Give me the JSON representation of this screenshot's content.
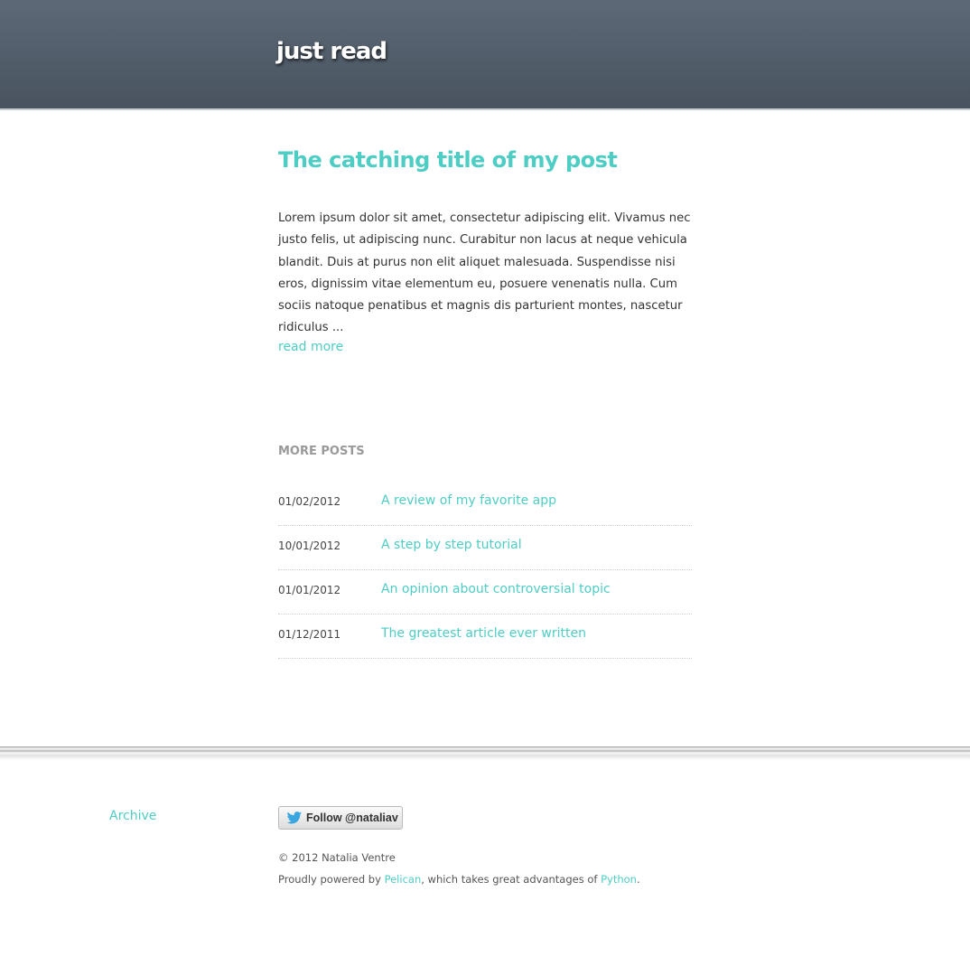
{
  "header": {
    "site_title": "just read"
  },
  "post": {
    "title": "The catching title of my post",
    "summary": "Lorem ipsum dolor sit amet, consectetur adipiscing elit. Vivamus nec justo felis, ut adipiscing nunc. Curabitur non lacus at neque vehicula blandit. Duis at purus non elit aliquet malesuada. Suspendisse nisi eros, dignissim vitae elementum eu, posuere venenatis nulla. Cum sociis natoque penatibus et magnis dis parturient montes, nascetur ridiculus ...",
    "read_more": "read more"
  },
  "more_posts": {
    "heading": "MORE POSTS",
    "items": [
      {
        "date": "01/02/2012",
        "title": "A review of my favorite app"
      },
      {
        "date": "10/01/2012",
        "title": "A step by step tutorial"
      },
      {
        "date": "01/01/2012",
        "title": "An opinion about controversial topic"
      },
      {
        "date": "01/12/2011",
        "title": "The greatest article ever written"
      }
    ]
  },
  "footer": {
    "archive": "Archive",
    "follow_button": "Follow @nataliav",
    "copyright": "© 2012 Natalia Ventre",
    "powered_prefix": "Proudly powered by ",
    "pelican": "Pelican",
    "powered_middle": ", which takes great advantages of ",
    "python": "Python",
    "powered_suffix": "."
  },
  "colors": {
    "accent": "#4ecdc4",
    "header_bg": "#56626f",
    "text": "#333333",
    "muted": "#999999"
  },
  "icons": {
    "twitter": "twitter-bird-icon"
  }
}
